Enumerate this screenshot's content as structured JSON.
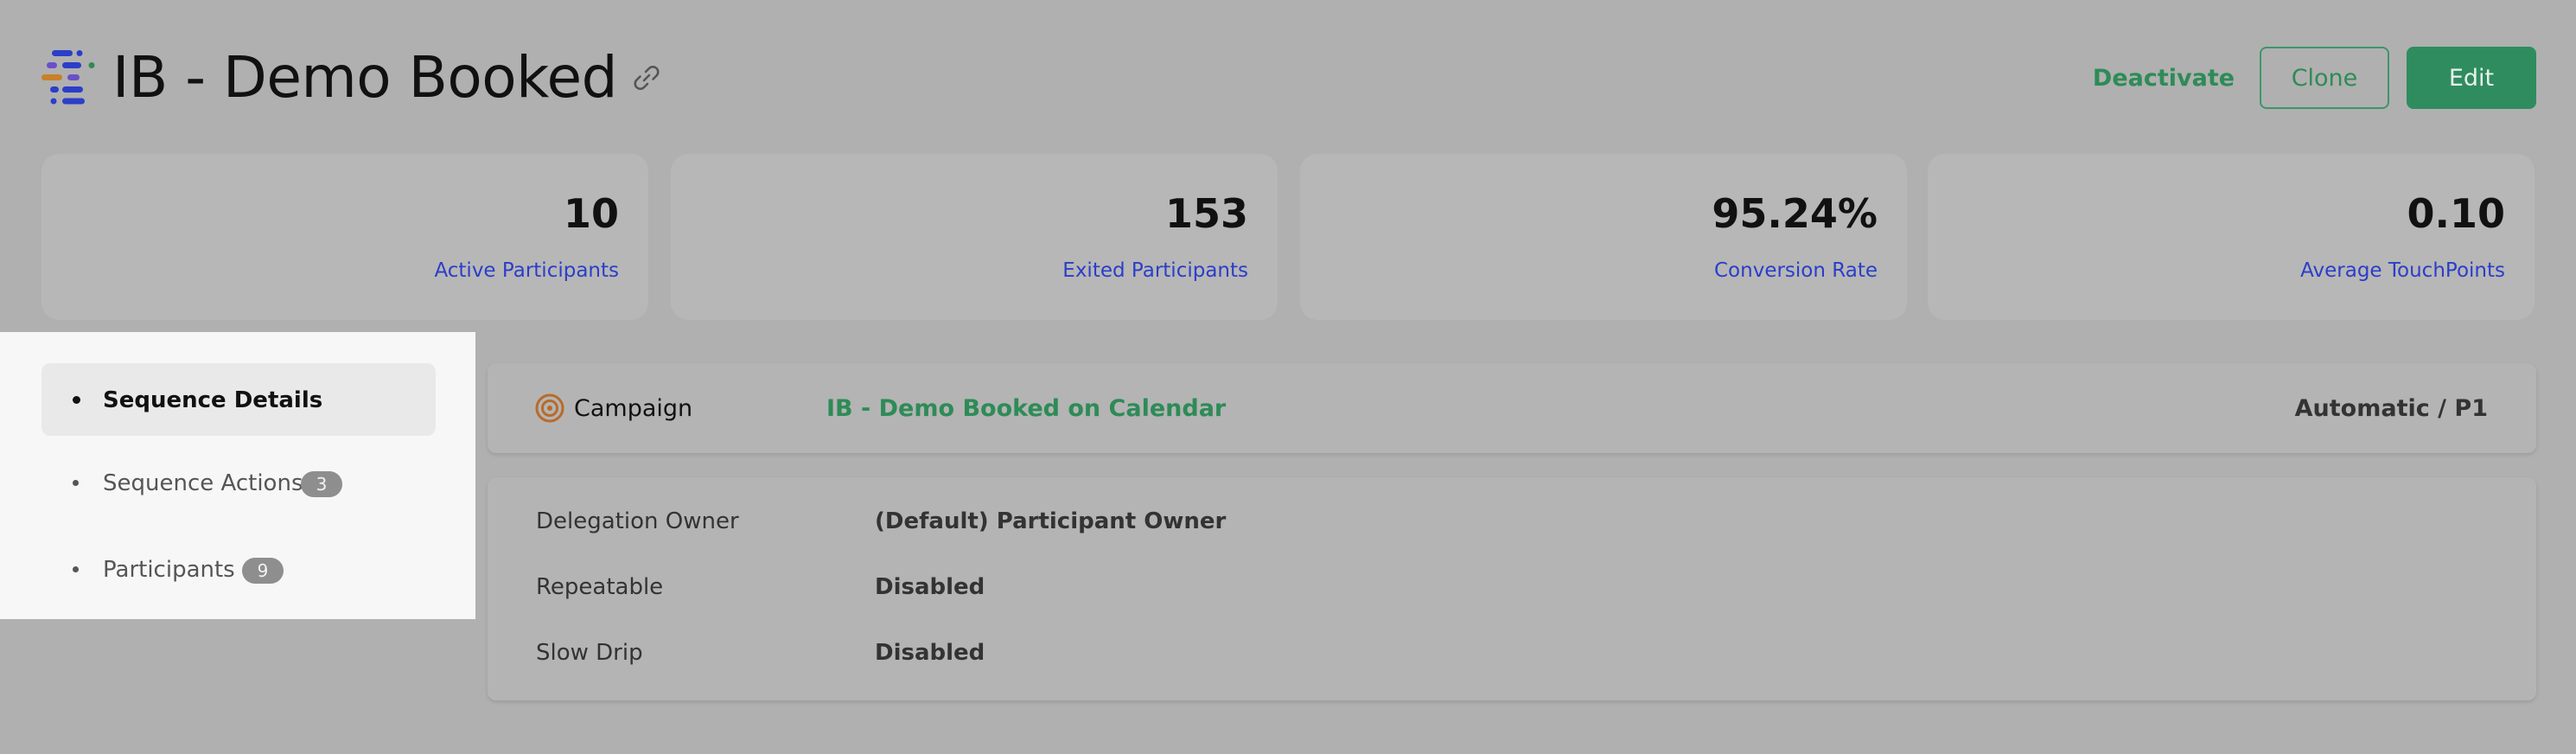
{
  "header": {
    "title": "IB - Demo Booked",
    "logo_icon": "sequence-logo-icon",
    "link_icon": "link-icon",
    "actions": {
      "deactivate_label": "Deactivate",
      "clone_label": "Clone",
      "edit_label": "Edit"
    }
  },
  "stats": [
    {
      "value": "10",
      "label": "Active Participants"
    },
    {
      "value": "153",
      "label": "Exited Participants"
    },
    {
      "value": "95.24%",
      "label": "Conversion Rate"
    },
    {
      "value": "0.10",
      "label": "Average TouchPoints"
    }
  ],
  "sidebar": {
    "items": [
      {
        "label": "Sequence Details",
        "active": true
      },
      {
        "label": "Sequence Actions",
        "badge": "3"
      },
      {
        "label": "Participants",
        "badge": "9"
      }
    ]
  },
  "campaign": {
    "icon": "target-icon",
    "label": "Campaign",
    "value": "IB - Demo Booked on Calendar",
    "mode": "Automatic / P1"
  },
  "details": [
    {
      "key": "Delegation Owner",
      "value": "(Default) Participant Owner"
    },
    {
      "key": "Repeatable",
      "value": "Disabled"
    },
    {
      "key": "Slow Drip",
      "value": "Disabled"
    }
  ],
  "colors": {
    "accent_green": "#2e8b57",
    "link_blue": "#2b3ec8",
    "background": "#b0b0b0",
    "sidebar_bg": "#f7f7f7"
  }
}
